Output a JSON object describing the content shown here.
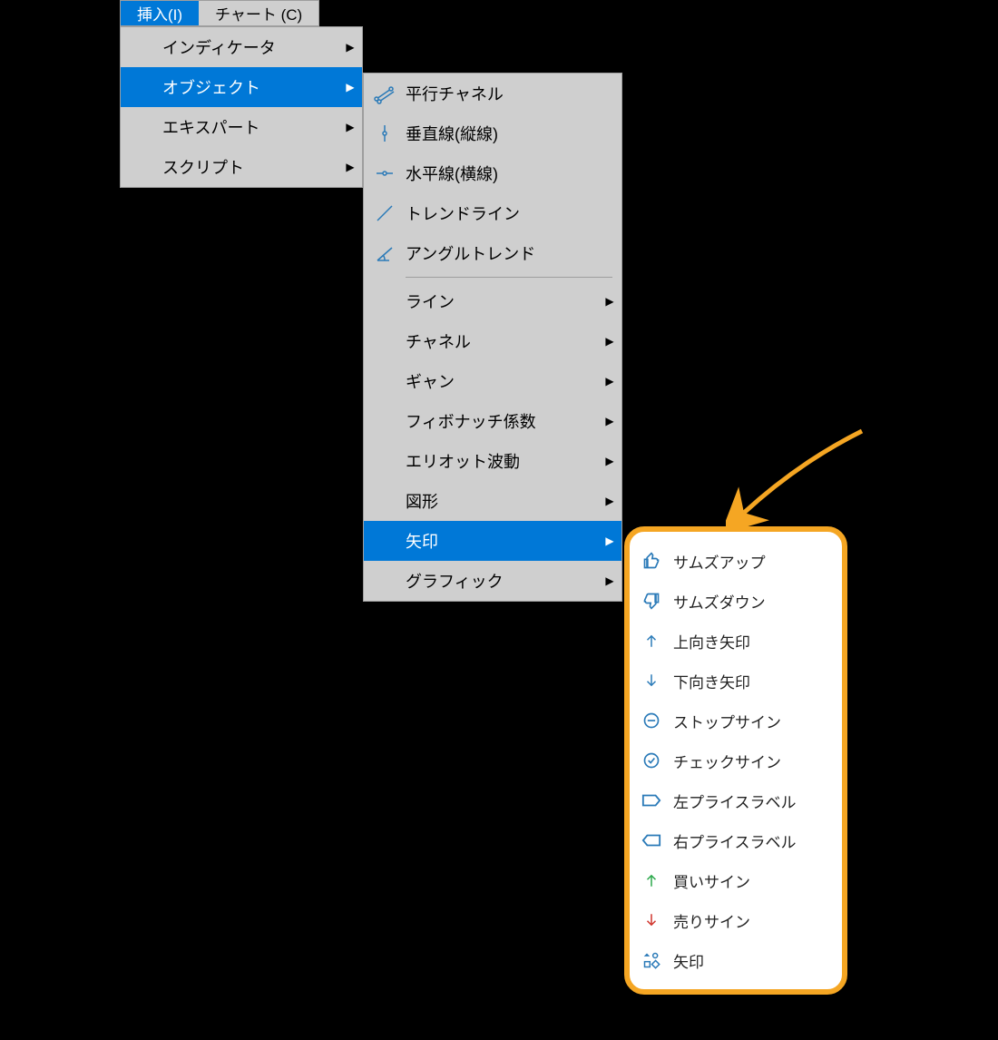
{
  "menubar": {
    "tabs": [
      {
        "label": "挿入(I)",
        "active": true
      },
      {
        "label": "チャート (C)",
        "active": false
      }
    ]
  },
  "menu1": {
    "items": [
      {
        "label": "インディケータ",
        "arrow": true,
        "hover": false
      },
      {
        "label": "オブジェクト",
        "arrow": true,
        "hover": true
      },
      {
        "label": "エキスパート",
        "arrow": true,
        "hover": false
      },
      {
        "label": "スクリプト",
        "arrow": true,
        "hover": false
      }
    ]
  },
  "menu2": {
    "items_top": [
      {
        "label": "平行チャネル",
        "icon": "equidistant"
      },
      {
        "label": "垂直線(縦線)",
        "icon": "vline"
      },
      {
        "label": "水平線(横線)",
        "icon": "hline"
      },
      {
        "label": "トレンドライン",
        "icon": "trend"
      },
      {
        "label": "アングルトレンド",
        "icon": "angle"
      }
    ],
    "items_mid": [
      {
        "label": "ライン"
      },
      {
        "label": "チャネル"
      },
      {
        "label": "ギャン"
      },
      {
        "label": "フィボナッチ係数"
      },
      {
        "label": "エリオット波動"
      },
      {
        "label": "図形"
      }
    ],
    "items_sel": {
      "label": "矢印"
    },
    "items_bot": [
      {
        "label": "グラフィック"
      }
    ]
  },
  "popup": {
    "items": [
      {
        "label": "サムズアップ",
        "icon": "thumbup"
      },
      {
        "label": "サムズダウン",
        "icon": "thumbdown"
      },
      {
        "label": "上向き矢印",
        "icon": "arrowup"
      },
      {
        "label": "下向き矢印",
        "icon": "arrowdown"
      },
      {
        "label": "ストップサイン",
        "icon": "stop"
      },
      {
        "label": "チェックサイン",
        "icon": "check"
      },
      {
        "label": "左プライスラベル",
        "icon": "labelL"
      },
      {
        "label": "右プライスラベル",
        "icon": "labelR"
      },
      {
        "label": "買いサイン",
        "icon": "buy"
      },
      {
        "label": "売りサイン",
        "icon": "sell"
      },
      {
        "label": "矢印",
        "icon": "shapes"
      }
    ]
  }
}
